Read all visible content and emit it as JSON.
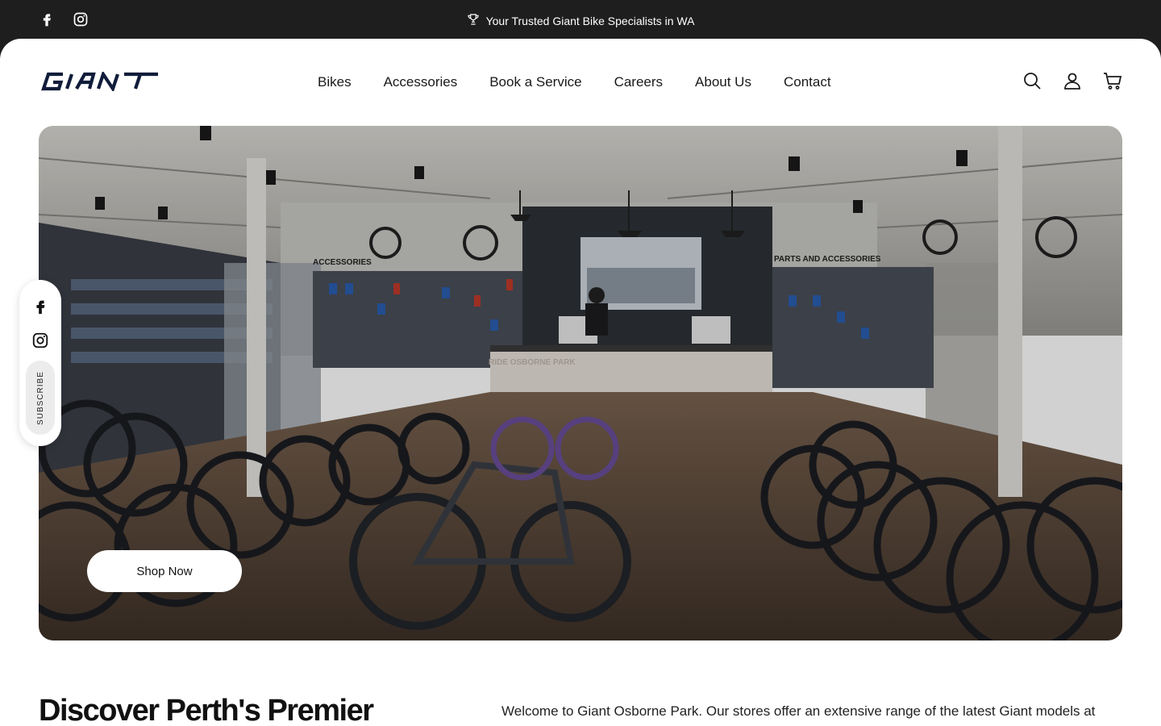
{
  "topbar": {
    "announcement": "Your Trusted Giant Bike Specialists in WA",
    "announcement_icon": "trophy-icon",
    "social": [
      "facebook-icon",
      "instagram-icon"
    ]
  },
  "header": {
    "logo_alt": "GIANT",
    "nav": [
      "Bikes",
      "Accessories",
      "Book a Service",
      "Careers",
      "About Us",
      "Contact"
    ],
    "icons": [
      "search-icon",
      "account-icon",
      "cart-icon"
    ]
  },
  "hero": {
    "store_signs": {
      "left": "ACCESSORIES",
      "right": "PARTS AND ACCESSORIES",
      "counter": "RIDE OSBORNE PARK"
    },
    "cta": "Shop Now"
  },
  "floating_social": {
    "icons": [
      "facebook-icon",
      "instagram-icon"
    ],
    "subscribe": "SUBSCRIBE"
  },
  "intro": {
    "title": "Discover Perth's Premier",
    "text": "Welcome to Giant Osborne Park. Our stores offer an extensive range of the latest Giant models at"
  },
  "colors": {
    "topbar_bg": "#1e1e1e",
    "brand_navy": "#101c3a",
    "panel_bg": "#ffffff"
  }
}
